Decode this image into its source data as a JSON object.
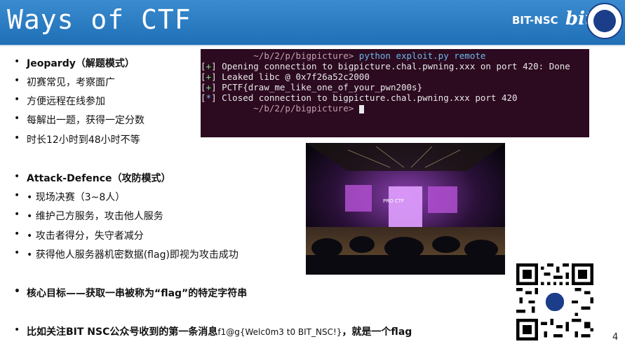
{
  "header": {
    "title": "Ways of CTF",
    "brand": "BIT-NSC",
    "logo_text": "bit"
  },
  "bullets": {
    "jeopardy": {
      "title_en": "Jeopardy",
      "title_zh": "（解题模式）",
      "items": [
        "初赛常见，考察面广",
        "方便远程在线参加",
        "每解出一题，获得一定分数",
        "时长12小时到48小时不等"
      ]
    },
    "attack_defence": {
      "title_en": "Attack-Defence",
      "title_zh": "（攻防模式）",
      "items": [
        "• 现场决赛（3~8人）",
        "• 维护己方服务，攻击他人服务",
        "• 攻击者得分，失守者减分",
        "• 获得他人服务器机密数据(flag)即视为攻击成功"
      ]
    },
    "goal": "核心目标——获取一串被称为“flag”的特定字符串",
    "example_prefix": "比如关注BIT NSC公众号收到的第一条消息",
    "example_flag": "f1@g{Welc0m3 t0 BIT_NSC!}",
    "example_suffix": "，就是一个flag"
  },
  "terminal": {
    "prompt1": "~/b/2/p/bigpicture>",
    "command": "python exploit.py remote",
    "lines": [
      {
        "mark": "+",
        "text": "Opening connection to bigpicture.chal.pwning.xxx on port 420: Done"
      },
      {
        "mark": "+",
        "text": "Leaked libc @ 0x7f26a52c2000"
      },
      {
        "mark": "+",
        "text": "PCTF{draw_me_like_one_of_your_pwn200s}"
      },
      {
        "mark": "*",
        "text": "Closed connection to bigpicture.chal.pwning.xxx port 420"
      }
    ],
    "prompt2": "~/b/2/p/bigpicture>"
  },
  "photo": {
    "screen_text": "PRO CTF"
  },
  "page_number": "4",
  "colors": {
    "header_blue": "#1f6fb6",
    "terminal_bg": "#2c0a20",
    "terminal_green": "#6fe36f"
  }
}
